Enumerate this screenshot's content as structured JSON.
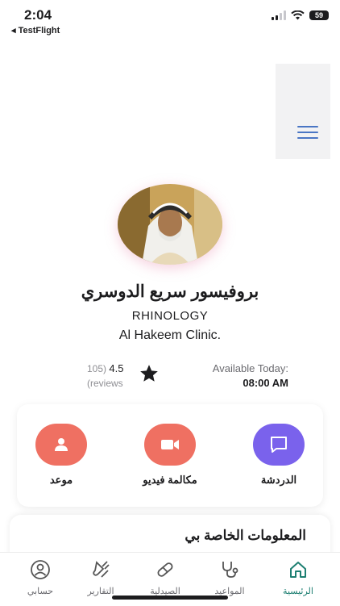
{
  "status_bar": {
    "time": "2:04",
    "back_app": "◂ TestFlight",
    "battery": "59"
  },
  "doctor": {
    "name": "بروفيسور سريع الدوسري",
    "specialty": "RHINOLOGY",
    "clinic": "Al Hakeem Clinic.",
    "rating": "4.5",
    "reviews_count": "105)",
    "reviews_word": "(reviews",
    "available_label": "Available Today:",
    "available_time": "08:00 AM"
  },
  "actions": {
    "appointment": "موعد",
    "video_call": "مكالمة فيديو",
    "chat": "الدردشة"
  },
  "colors": {
    "coral": "#ef7062",
    "purple": "#7a62ec",
    "teal": "#1e7f72",
    "menu": "#4a76c4"
  },
  "info": {
    "title": "المعلومات الخاصة بي"
  },
  "nav": {
    "account": "حسابي",
    "reports": "التقارير",
    "pharmacy": "الصيدلية",
    "appointments": "المواعيد",
    "home": "الرئيسية"
  }
}
